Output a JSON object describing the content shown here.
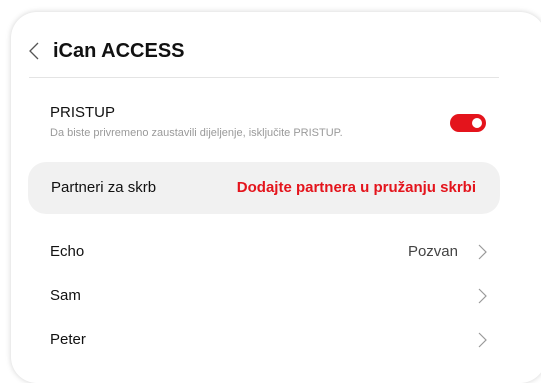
{
  "header": {
    "title": "iCan ACCESS",
    "back_icon": "chevron-left-icon"
  },
  "access": {
    "label": "PRISTUP",
    "description": "Da biste privremeno zaustavili dijeljenje, isključite PRISTUP.",
    "toggle_on": true,
    "toggle_color": "#e4141c"
  },
  "partners": {
    "label": "Partneri za skrb",
    "add_link": "Dodajte partnera u pružanju skrbi",
    "link_color": "#e4141c"
  },
  "contacts": [
    {
      "name": "Echo",
      "status": "Pozvan"
    },
    {
      "name": "Sam",
      "status": ""
    },
    {
      "name": "Peter",
      "status": ""
    }
  ]
}
